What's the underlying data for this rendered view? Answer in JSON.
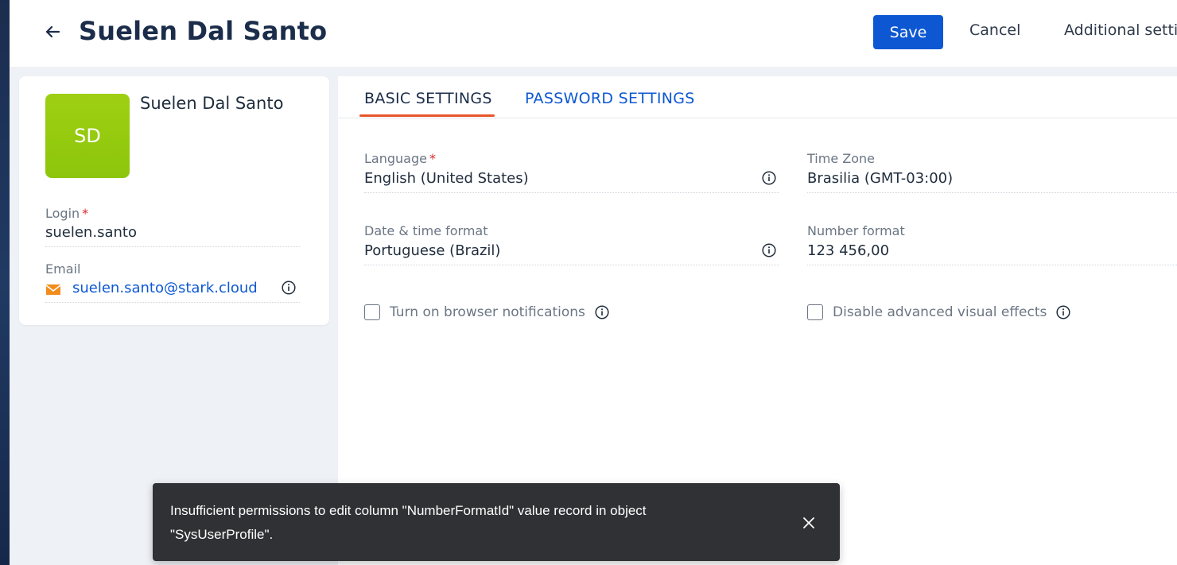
{
  "header": {
    "title": "Suelen Dal Santo",
    "save_label": "Save",
    "cancel_label": "Cancel",
    "additional_label": "Additional setti"
  },
  "profile": {
    "initials": "SD",
    "name": "Suelen Dal Santo",
    "avatar_color": "#9acd0f",
    "login_label": "Login",
    "login_value": "suelen.santo",
    "email_label": "Email",
    "email_value": "suelen.santo@stark.cloud"
  },
  "tabs": [
    {
      "label": "BASIC SETTINGS",
      "active": true
    },
    {
      "label": "PASSWORD SETTINGS",
      "active": false
    }
  ],
  "basic_settings": {
    "language": {
      "label": "Language",
      "value": "English (United States)",
      "required": true
    },
    "timezone": {
      "label": "Time Zone",
      "value": "Brasilia (GMT-03:00)"
    },
    "datetime_format": {
      "label": "Date & time format",
      "value": "Portuguese (Brazil)"
    },
    "number_format": {
      "label": "Number format",
      "value": "123 456,00"
    },
    "browser_notifications": {
      "label": "Turn on browser notifications",
      "checked": false
    },
    "disable_visual_effects": {
      "label": "Disable advanced visual effects",
      "checked": false
    }
  },
  "toast": {
    "message": "Insufficient permissions to edit column \"NumberFormatId\" value record in object \"SysUserProfile\"."
  },
  "colors": {
    "primary": "#0d58d2",
    "tab_accent": "#e8542b",
    "required": "#d92b2b",
    "toast_bg": "#2f3134",
    "email_icon": "#f28c1c"
  }
}
